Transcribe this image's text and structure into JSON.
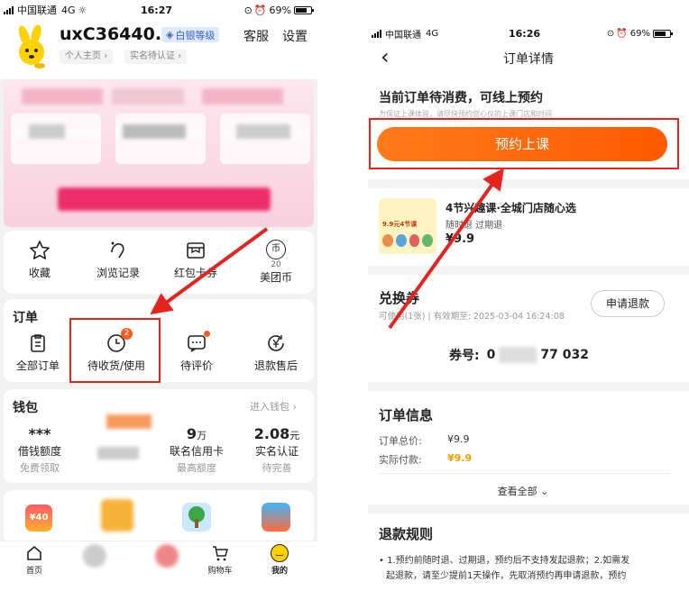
{
  "left": {
    "status": {
      "carrier": "中国联通",
      "network": "4G",
      "time": "16:27",
      "battery": "69%"
    },
    "profile": {
      "username": "uxC36440...",
      "level_badge": "白银等级",
      "service": "客服",
      "settings": "设置",
      "homepage": "个人主页",
      "verify": "实名待认证"
    },
    "quick": [
      {
        "label": "收藏",
        "icon": "star-icon"
      },
      {
        "label": "浏览记录",
        "icon": "footprint-icon"
      },
      {
        "label": "红包卡券",
        "icon": "coupon-icon"
      },
      {
        "label": "美团币",
        "icon": "coin-icon",
        "coin_badge": "币",
        "coin_count": "20"
      }
    ],
    "orders": {
      "title": "订单",
      "items": [
        {
          "label": "全部订单",
          "icon": "clipboard-icon"
        },
        {
          "label": "待收货/使用",
          "icon": "clock-icon",
          "badge": "2"
        },
        {
          "label": "待评价",
          "icon": "chat-icon"
        },
        {
          "label": "退款售后",
          "icon": "refund-icon"
        }
      ]
    },
    "wallet": {
      "title": "钱包",
      "enter": "进入钱包",
      "items": [
        {
          "value": "***",
          "label": "借钱额度",
          "sub": "免费领取"
        },
        {
          "value": "9",
          "unit": "万",
          "label": "联名信用卡",
          "sub": "最高额度"
        },
        {
          "value": "2.08",
          "unit": "元",
          "label": "实名认证",
          "sub": "待完善"
        }
      ]
    },
    "tabbar": [
      {
        "label": "首页",
        "icon": "home-icon"
      },
      {
        "label": "",
        "icon": "tab2-icon"
      },
      {
        "label": "",
        "icon": "tab3-icon"
      },
      {
        "label": "购物车",
        "icon": "cart-icon"
      },
      {
        "label": "我的",
        "icon": "mine-icon"
      }
    ],
    "promo_badge": "¥40"
  },
  "right": {
    "status": {
      "carrier": "中国联通",
      "network": "4G",
      "time": "16:26",
      "battery": "69%"
    },
    "nav_title": "订单详情",
    "notice_title": "当前订单待消费，可线上预约",
    "notice_sub": "为保证上课体验，请尽快预约您心仪的上课门店和时间",
    "book_button": "预约上课",
    "product": {
      "name": "4节兴趣课·全城门店随心选",
      "tags": "随时退 过期退",
      "price": "¥9.9",
      "thumb_text": "9.9元4节课"
    },
    "voucher": {
      "title": "兑换券",
      "meta": "可使用(1张) | 有效期至: 2025-03-04 16:24:08",
      "refund_button": "申请退款",
      "code_label": "券号:",
      "code_prefix": "0",
      "code_suffix": "77 032"
    },
    "order_info": {
      "title": "订单信息",
      "total_label": "订单总价:",
      "total_value": "¥9.9",
      "paid_label": "实际付款:",
      "paid_value": "¥9.9",
      "view_all": "查看全部"
    },
    "refund_rules": {
      "title": "退款规则",
      "line1": "• 1.预约前随时退、过期退，预约后不支持发起退款；2.如需发",
      "line2": "起退款，请至少提前1天操作，先取消预约再申请退款，预约"
    }
  },
  "colors": {
    "accent": "#ff6a1a",
    "annotation": "#e5241f",
    "badge_blue": "#dfe9ff"
  }
}
